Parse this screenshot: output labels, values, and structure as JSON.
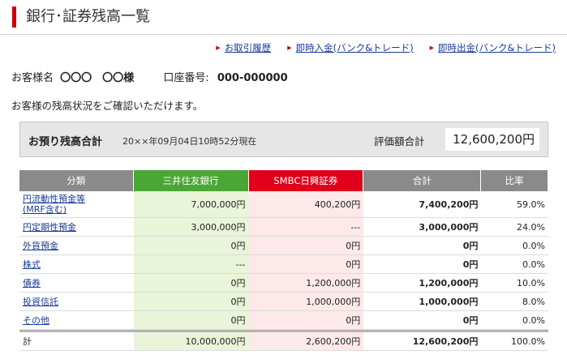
{
  "page": {
    "title": "銀行･証券残高一覧"
  },
  "links": [
    "お取引履歴",
    "即時入金(バンク&トレード)",
    "即時出金(バンク&トレード)"
  ],
  "customer": {
    "label": "お客様名",
    "name": "〇〇〇　〇〇様",
    "account_label": "口座番号:",
    "account_number": "000-000000"
  },
  "intro": "お客様の残高状況をご確認いただけます。",
  "summary": {
    "label": "お預り残高合計",
    "as_of": "20××年09月04日10時52分現在",
    "eval_label": "評価額合計",
    "eval_value": "12,600,200円"
  },
  "colors": {
    "accent": "#cc0000",
    "bank": "#4aa736",
    "securities": "#e0001b",
    "header_gray": "#8a8a8a"
  },
  "table": {
    "headers": {
      "category": "分類",
      "bank": "三井住友銀行",
      "securities": "SMBC日興証券",
      "total": "合計",
      "ratio": "比率"
    },
    "rows": [
      {
        "category": "円流動性預金等",
        "category2": "(MRF含む)",
        "bank": "7,000,000円",
        "securities": "400,200円",
        "total": "7,400,200円",
        "ratio": "59.0%"
      },
      {
        "category": "円定期性預金",
        "bank": "3,000,000円",
        "securities": "---",
        "total": "3,000,000円",
        "ratio": "24.0%"
      },
      {
        "category": "外貨預金",
        "bank": "0円",
        "securities": "0円",
        "total": "0円",
        "ratio": "0.0%"
      },
      {
        "category": "株式",
        "bank": "---",
        "securities": "0円",
        "total": "0円",
        "ratio": "0.0%"
      },
      {
        "category": "債券",
        "bank": "0円",
        "securities": "1,200,000円",
        "total": "1,200,000円",
        "ratio": "10.0%"
      },
      {
        "category": "投資信託",
        "bank": "0円",
        "securities": "1,000,000円",
        "total": "1,000,000円",
        "ratio": "8.0%"
      },
      {
        "category": "その他",
        "bank": "0円",
        "securities": "0円",
        "total": "0円",
        "ratio": "0.0%"
      }
    ],
    "total_row": {
      "category": "計",
      "bank": "10,000,000円",
      "securities": "2,600,200円",
      "total": "12,600,200円",
      "ratio": "100.0%"
    }
  }
}
